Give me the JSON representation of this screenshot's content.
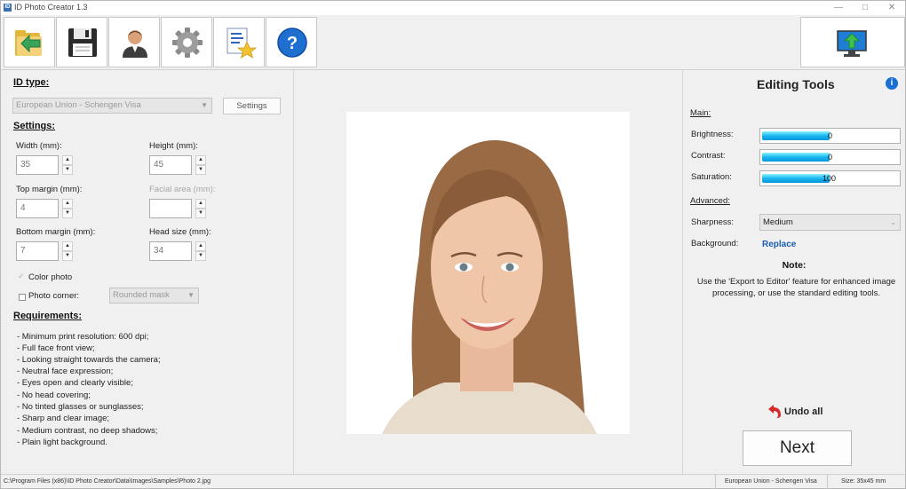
{
  "window": {
    "title": "ID Photo Creator 1.3",
    "app_icon": "ID",
    "min": "—",
    "max": "□",
    "close": "✕"
  },
  "toolbar": {
    "buttons": [
      {
        "name": "open-folder-icon"
      },
      {
        "name": "save-disk-icon"
      },
      {
        "name": "person-icon"
      },
      {
        "name": "gear-icon"
      },
      {
        "name": "document-star-icon"
      },
      {
        "name": "help-icon",
        "glyph": "?"
      }
    ],
    "export_icon": "monitor-upload-icon"
  },
  "left": {
    "id_type_header": "ID type:",
    "id_type_value": "European Union - Schengen Visa",
    "settings_button": "Settings",
    "settings_header": "Settings:",
    "width_label": "Width (mm):",
    "width_value": "35",
    "height_label": "Height (mm):",
    "height_value": "45",
    "top_margin_label": "Top margin (mm):",
    "top_margin_value": "4",
    "facial_area_label": "Facial area (mm):",
    "facial_area_value": "",
    "bottom_margin_label": "Bottom margin (mm):",
    "bottom_margin_value": "7",
    "head_size_label": "Head size (mm):",
    "head_size_value": "34",
    "color_photo_label": "Color photo",
    "photo_corner_label": "Photo corner:",
    "photo_corner_value": "Rounded mask",
    "requirements_header": "Requirements:",
    "requirements": [
      "- Minimum print resolution: 600 dpi;",
      "- Full face front view;",
      "- Looking straight towards the camera;",
      "- Neutral face expression;",
      "- Eyes open and clearly visible;",
      "- No head covering;",
      "- No tinted glasses or sunglasses;",
      "- Sharp and clear image;",
      "- Medium contrast, no deep shadows;",
      "- Plain light background."
    ]
  },
  "right": {
    "title": "Editing Tools",
    "info": "i",
    "main_header": "Main:",
    "brightness_label": "Brightness:",
    "brightness_value": "0",
    "contrast_label": "Contrast:",
    "contrast_value": "0",
    "saturation_label": "Saturation:",
    "saturation_value": "100",
    "advanced_header": "Advanced:",
    "sharpness_label": "Sharpness:",
    "sharpness_value": "Medium",
    "background_label": "Background:",
    "background_link": "Replace",
    "note_title": "Note:",
    "note_text": "Use the 'Export to Editor' feature for enhanced image processing, or use the standard editing tools.",
    "undo_label": "Undo all",
    "next_label": "Next",
    "accent": "#1a5fb4"
  },
  "status": {
    "path": "C:\\Program Files (x86)\\ID Photo Creator\\Data\\Images\\Samples\\Photo 2.jpg",
    "format": "European Union - Schengen Visa",
    "size": "Size: 35x45 mm"
  }
}
